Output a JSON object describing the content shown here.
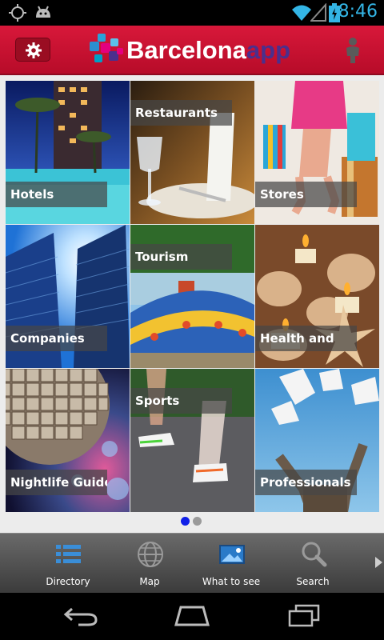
{
  "status": {
    "time": "8:46",
    "icons": [
      "gps-icon",
      "android-debug-icon",
      "wifi-icon",
      "signal-icon",
      "battery-icon"
    ]
  },
  "header": {
    "brand_main": "Barcelona",
    "brand_suffix": "app",
    "settings_icon": "gear-icon",
    "user_icon": "person-icon",
    "colors": {
      "bar": "#c8102e",
      "brand_suffix": "#4b2f8c"
    }
  },
  "categories": [
    {
      "label": "Hotels"
    },
    {
      "label": "Restaurants"
    },
    {
      "label": "Stores"
    },
    {
      "label": "Companies"
    },
    {
      "label": "Tourism"
    },
    {
      "label": "Health and"
    },
    {
      "label": "Nightlife Guide"
    },
    {
      "label": "Sports"
    },
    {
      "label": "Professionals"
    }
  ],
  "pager": {
    "current": 1,
    "total": 2
  },
  "tabbar": {
    "tabs": [
      {
        "label": "Directory",
        "icon": "list-icon"
      },
      {
        "label": "Map",
        "icon": "globe-icon"
      },
      {
        "label": "What to see",
        "icon": "photo-icon"
      },
      {
        "label": "Search",
        "icon": "magnifier-icon"
      }
    ],
    "more_icon": "chevron-right-icon"
  },
  "navbar": {
    "icons": [
      "back-icon",
      "home-icon",
      "recent-apps-icon"
    ]
  }
}
